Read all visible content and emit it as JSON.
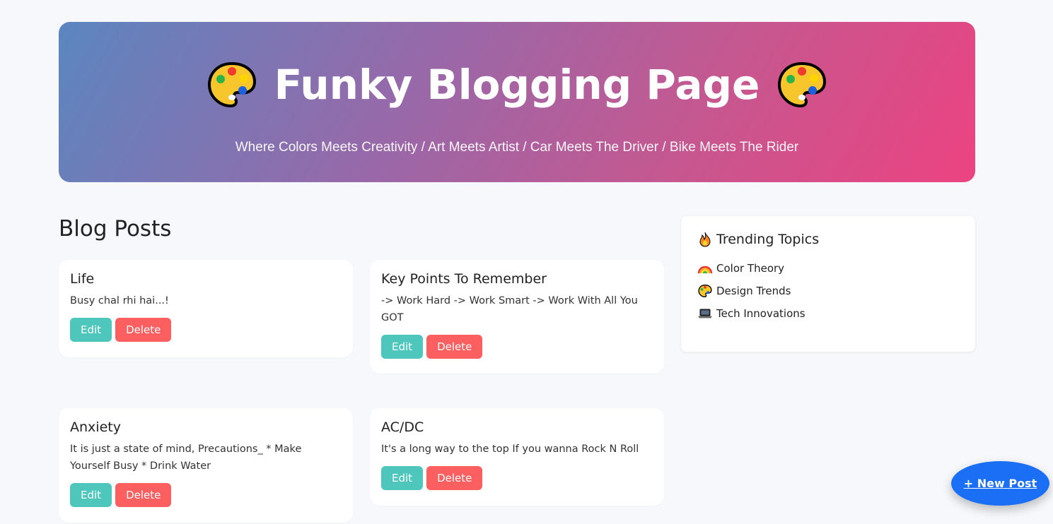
{
  "header": {
    "title": "Funky Blogging Page",
    "subtitle": "Where Colors Meets Creativity / Art Meets Artist / Car Meets The Driver / Bike Meets The Rider",
    "left_icon": "palette-icon",
    "right_icon": "palette-icon"
  },
  "main": {
    "section_title": "Blog Posts",
    "posts": [
      {
        "title": "Life",
        "body": "Busy chal rhi hai...!",
        "edit_label": "Edit",
        "delete_label": "Delete"
      },
      {
        "title": "Key Points To Remember",
        "body": "-> Work Hard -> Work Smart -> Work With All You GOT",
        "edit_label": "Edit",
        "delete_label": "Delete"
      },
      {
        "title": "Anxiety",
        "body": "It is just a state of mind, Precautions_ * Make Yourself Busy * Drink Water",
        "edit_label": "Edit",
        "delete_label": "Delete"
      },
      {
        "title": "AC/DC",
        "body": "It's a long way to the top If you wanna Rock N Roll",
        "edit_label": "Edit",
        "delete_label": "Delete"
      }
    ]
  },
  "sidebar": {
    "title": "Trending Topics",
    "title_icon": "fire-icon",
    "items": [
      {
        "label": "Color Theory",
        "icon": "rainbow-icon"
      },
      {
        "label": "Design Trends",
        "icon": "palette-icon"
      },
      {
        "label": "Tech Innovations",
        "icon": "laptop-icon"
      }
    ]
  },
  "fab": {
    "label": "+ New Post"
  },
  "colors": {
    "gradient_start": "#5b86c0",
    "gradient_end": "#ec4381",
    "edit_button": "#4ec6bc",
    "delete_button": "#fb5f5f",
    "fab": "#1a6ff5",
    "background": "#f7f8fb"
  }
}
